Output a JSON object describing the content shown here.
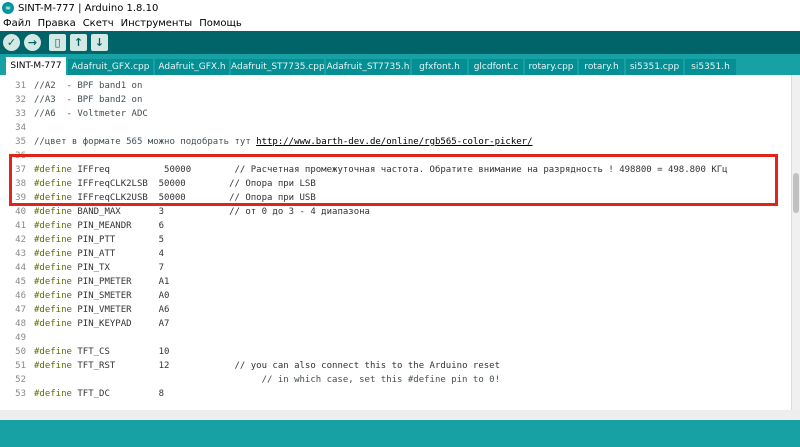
{
  "window": {
    "title": "SINT-M-777 | Arduino 1.8.10",
    "logo_text": "∞"
  },
  "menu": [
    "Файл",
    "Правка",
    "Скетч",
    "Инструменты",
    "Помощь"
  ],
  "toolbar": {
    "verify_icon": "✓",
    "upload_icon": "→",
    "new_icon": "▯",
    "open_icon": "↑",
    "save_icon": "↓"
  },
  "tabs": [
    {
      "label": "SINT-M-777",
      "active": true
    },
    {
      "label": "Adafruit_GFX.cpp"
    },
    {
      "label": "Adafruit_GFX.h"
    },
    {
      "label": "Adafruit_ST7735.cpp"
    },
    {
      "label": "Adafruit_ST7735.h"
    },
    {
      "label": "gfxfont.h"
    },
    {
      "label": "glcdfont.c"
    },
    {
      "label": "rotary.cpp"
    },
    {
      "label": "rotary.h"
    },
    {
      "label": "si5351.cpp"
    },
    {
      "label": "si5351.h"
    }
  ],
  "code_lines": [
    {
      "n": "31",
      "text": "//A2  - BPF band1 on"
    },
    {
      "n": "32",
      "text": "//A3  - BPF band2 on"
    },
    {
      "n": "33",
      "text": "//A6  - Voltmeter ADC"
    },
    {
      "n": "34",
      "text": ""
    },
    {
      "n": "35",
      "text": "//цвет в формате 565 можно подобрать тут ",
      "url": "http://www.barth-dev.de/online/rgb565-color-picker/"
    },
    {
      "n": "36",
      "text": ""
    },
    {
      "n": "37",
      "kw": "#define",
      "text": " IFFreq          50000        // Расчетная промежуточная частота. Обратите внимание на разрядность ! 498800 = 498.800 КГц"
    },
    {
      "n": "38",
      "kw": "#define",
      "text": " IFFreqCLK2LSB  50000        // Опора при LSB"
    },
    {
      "n": "39",
      "kw": "#define",
      "text": " IFFreqCLK2USB  50000        // Опора при USB"
    },
    {
      "n": "40",
      "kw": "#define",
      "text": " BAND_MAX       3            // от 0 до 3 - 4 диапазона"
    },
    {
      "n": "41",
      "kw": "#define",
      "text": " PIN_MEANDR     6"
    },
    {
      "n": "42",
      "kw": "#define",
      "text": " PIN_PTT        5"
    },
    {
      "n": "43",
      "kw": "#define",
      "text": " PIN_ATT        4"
    },
    {
      "n": "44",
      "kw": "#define",
      "text": " PIN_TX         7"
    },
    {
      "n": "45",
      "kw": "#define",
      "text": " PIN_PMETER     A1"
    },
    {
      "n": "46",
      "kw": "#define",
      "text": " PIN_SMETER     A0"
    },
    {
      "n": "47",
      "kw": "#define",
      "text": " PIN_VMETER     A6"
    },
    {
      "n": "48",
      "kw": "#define",
      "text": " PIN_KEYPAD     A7"
    },
    {
      "n": "49",
      "text": ""
    },
    {
      "n": "50",
      "kw": "#define",
      "text": " TFT_CS         10"
    },
    {
      "n": "51",
      "kw": "#define",
      "text": " TFT_RST        12            // you can also connect this to the Arduino reset"
    },
    {
      "n": "52",
      "text": "                                          // in which case, set this #define pin to 0!"
    },
    {
      "n": "53",
      "kw": "#define",
      "text": " TFT_DC         8"
    }
  ],
  "colors": {
    "teal_dark": "#006468",
    "teal": "#17a1a5",
    "highlight": "#e2231a"
  }
}
